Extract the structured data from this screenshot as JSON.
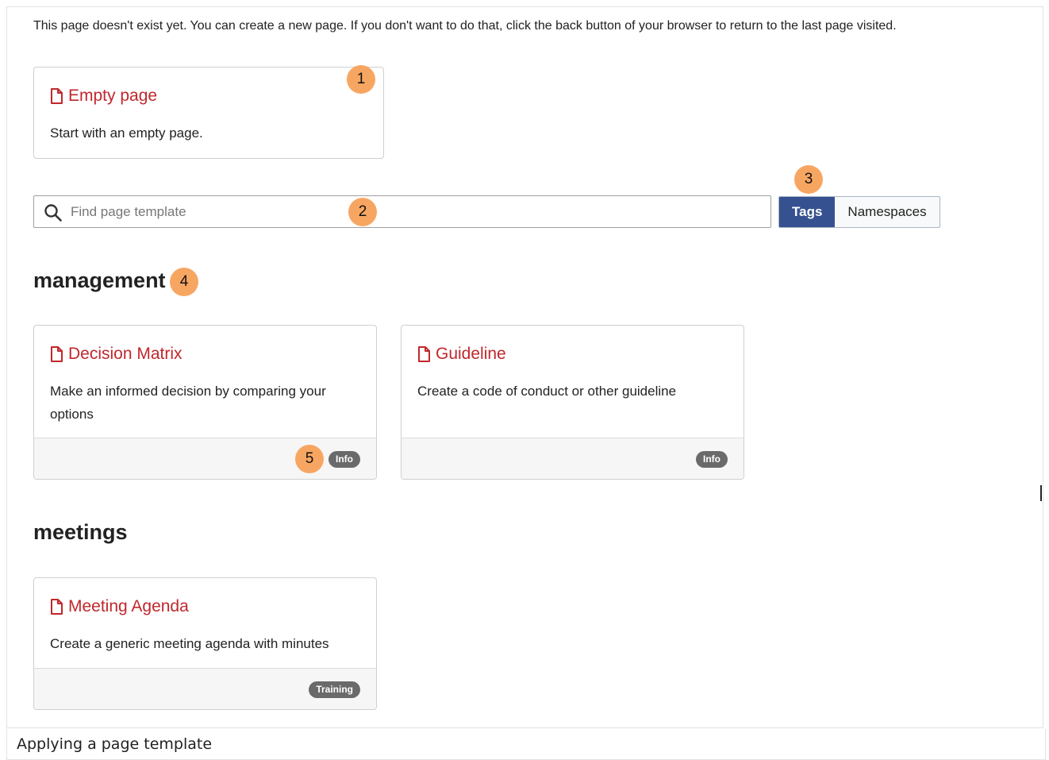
{
  "intro_text": "This page doesn't exist yet. You can create a new page. If you don't want to do that, click the back button of your browser to return to the last page visited.",
  "empty_card": {
    "title": "Empty page",
    "description": "Start with an empty page."
  },
  "search": {
    "placeholder": "Find page template",
    "value": ""
  },
  "view_toggle": {
    "tags_label": "Tags",
    "namespaces_label": "Namespaces",
    "active": "Tags"
  },
  "sections": [
    {
      "heading": "management",
      "cards": [
        {
          "title": "Decision Matrix",
          "description": "Make an informed decision by comparing your options",
          "tag": "Info"
        },
        {
          "title": "Guideline",
          "description": "Create a code of conduct or other guideline",
          "tag": "Info"
        }
      ]
    },
    {
      "heading": "meetings",
      "cards": [
        {
          "title": "Meeting Agenda",
          "description": "Create a generic meeting agenda with minutes",
          "tag": "Training"
        }
      ]
    }
  ],
  "markers": [
    "1",
    "2",
    "3",
    "4",
    "5"
  ],
  "caption": "Applying a page template",
  "colors": {
    "link_red": "#c1272d",
    "toggle_active": "#36518f",
    "marker": "#f7a662",
    "pill": "#6a6a6a"
  },
  "icons": {
    "template_icon": "document-icon",
    "search_icon": "search-icon"
  }
}
